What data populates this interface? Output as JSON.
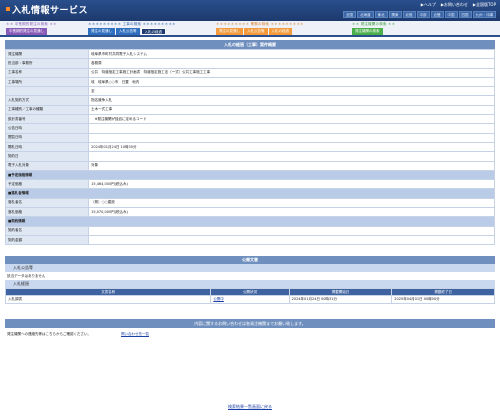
{
  "header": {
    "title": "入札情報サービス",
    "links": [
      "▶ヘルプ",
      "▶お問い合わせ",
      "▶全国版TOP"
    ],
    "regions": [
      "全国",
      "北海道",
      "東北",
      "関東",
      "北陸",
      "中部",
      "近畿",
      "中国",
      "四国",
      "九州・沖縄"
    ]
  },
  "nav": {
    "groups": [
      {
        "caption": "＊＊ 中長期的発注の検索 ＊＊",
        "color": "#8a5ab8",
        "tabs": [
          {
            "label": "中長期的発注の見通し",
            "color": "#8a5ab8",
            "active": false
          }
        ]
      },
      {
        "caption": "＊＊＊＊＊＊＊＊＊ 工事の検索 ＊＊＊＊＊＊＊＊＊",
        "color": "#2f5fae",
        "tabs": [
          {
            "label": "発注の見通し",
            "color": "#2f6fbf",
            "active": false
          },
          {
            "label": "入札公告等",
            "color": "#2f6fbf",
            "active": false
          },
          {
            "label": "入札の経過",
            "color": "#1d3a6e",
            "active": true
          }
        ]
      },
      {
        "caption": "＊＊＊＊＊＊＊＊＊ 業務の検索 ＊＊＊＊＊＊＊＊＊",
        "color": "#e07b1e",
        "tabs": [
          {
            "label": "発注の見通し",
            "color": "#f39a3c",
            "active": false
          },
          {
            "label": "入札公告等",
            "color": "#f39a3c",
            "active": false
          },
          {
            "label": "入札の経過",
            "color": "#f39a3c",
            "active": false
          }
        ]
      },
      {
        "caption": "＊＊ 発注機関の検索 ＊＊",
        "color": "#3a9a3a",
        "tabs": [
          {
            "label": "発注機関の検索",
            "color": "#4aae4a",
            "active": false
          }
        ]
      }
    ]
  },
  "section_title": "入札の経過（工事）案件概要",
  "rows": [
    {
      "label": "発注機関",
      "value": "岐阜県市町村共同電子入札システム"
    },
    {
      "label": "担当部・事務所",
      "value": "各務原"
    },
    {
      "label": "工事名称",
      "value": "公共　特道指定工事施工計画書　特道指定施工法（ー式）公共工事施工工事"
    },
    {
      "label": "工事場所",
      "value": "岐　岐阜県○○市　日置　地内"
    },
    {
      "label": "",
      "value": "至"
    },
    {
      "label": "入札契約方式",
      "value": "指名競争入札"
    },
    {
      "label": "工事種別／工事の種類",
      "value": "土木一式工事"
    },
    {
      "label": "設計書番号",
      "value": "　※発注機関が独自に定めるコード"
    },
    {
      "label": "公告日時",
      "value": ""
    },
    {
      "label": "閲覧日時",
      "value": ""
    },
    {
      "label": "開札日時",
      "value": "2024年01月24日 10時30分"
    },
    {
      "label": "契約日",
      "value": ""
    },
    {
      "label": "電子入札対象",
      "value": "対象"
    },
    {
      "label": "■予定価格情報",
      "value": "",
      "sub": true
    },
    {
      "label": "予定価格",
      "value": "15,464,000円(税込み)"
    },
    {
      "label": "■落札者情報",
      "value": "",
      "sub": true
    },
    {
      "label": "落札者名",
      "value": "（株）○○建設"
    },
    {
      "label": "落札価格",
      "value": "15,070,000円(税込み)"
    },
    {
      "label": "■契約情報",
      "value": "",
      "sub": true
    },
    {
      "label": "契約者名",
      "value": ""
    },
    {
      "label": "契約金額",
      "value": ""
    }
  ],
  "documents": {
    "title": "公開文書",
    "announcement_head": "入札公告等",
    "announcement_text": "該当データはありません",
    "progress_head": "入札経過",
    "columns": [
      "文書名称",
      "公開状況",
      "掲載開始日",
      "掲載終了日"
    ],
    "rows": [
      {
        "name": "入札調書",
        "status": "公開中",
        "start": "2024年01月24日 00時31分",
        "end": "2025年04月01日 00時00分"
      }
    ]
  },
  "inquiry": {
    "head": "内容に関するお問い合わせは各発注機関までお願い致します。",
    "text": "発注機関への連絡先等はこちらからご確認ください。",
    "link": "問い合わせ先一覧"
  },
  "return_link": "検索結果一覧画面に戻る"
}
